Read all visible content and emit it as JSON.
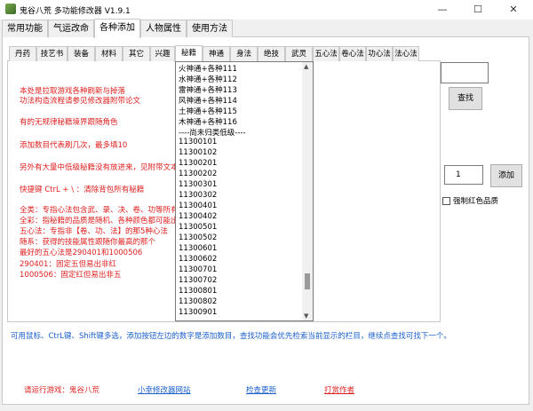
{
  "window": {
    "title": "鬼谷八荒 多功能修改器 V1.9.1",
    "minimize": "—",
    "maximize": "☐",
    "close": "✕"
  },
  "main_tabs": [
    "常用功能",
    "气运改命",
    "各种添加",
    "人物属性",
    "使用方法"
  ],
  "sub_tabs": [
    "丹药",
    "技艺书",
    "装备",
    "材料",
    "其它",
    "兴趣",
    "秘籍",
    "神通",
    "身法",
    "绝技",
    "武灵",
    "五心法",
    "卷心法",
    "功心法",
    "法心法"
  ],
  "notes": [
    "本处是拉取游戏各种刷新与掉落",
    "功法构造流程请参见修改器附带论文",
    "有的无规律秘籍境界跟随角色",
    "添加数目代表刷几次，最多填10",
    "另外有大量中低级秘籍没有放进来，见附带文本",
    "快捷键 CtrL + \\ ：清除背包所有秘籍",
    "全类：专指心法包含武、录、决、卷、功等所有",
    "全彩：指秘籍的品质是随机、各种颜色都可能出",
    "五心法：专指非【卷、功、法】的那5种心法",
    "随系：获得的技能属性跟随你最高的那个",
    "最好的五心法是290401和1000506",
    "290401：固定五但易出非红",
    "1000506：固定红但易出非五"
  ],
  "list_items": [
    "火神通+各种111",
    "水神通+各种112",
    "雷神通+各种113",
    "风神通+各种114",
    "土神通+各种115",
    "木神通+各种116",
    "----尚未归类低级----",
    "11300101",
    "11300102",
    "11300201",
    "11300202",
    "11300301",
    "11300302",
    "11300401",
    "11300402",
    "11300501",
    "11300502",
    "11300601",
    "11300602",
    "11300701",
    "11300702",
    "11300801",
    "11300802",
    "11300901"
  ],
  "search_button": "查找",
  "quantity_value": "1",
  "add_button": "添加",
  "force_red_label": "强制红色品质",
  "hint": "可用鼠标、CtrL键、Shift键多选，添加按钮左边的数字是添加数目，查找功能会优先检索当前显示的栏目，继续点查找可找下一个。",
  "footer": {
    "game_label": "请运行游戏：鬼谷八荒",
    "site_link": "小幸修改器网站",
    "update_link": "检查更新",
    "donate_link": "打赏作者"
  },
  "colors": {
    "red_text": "#e02020",
    "blue_text": "#1a5fcc"
  }
}
